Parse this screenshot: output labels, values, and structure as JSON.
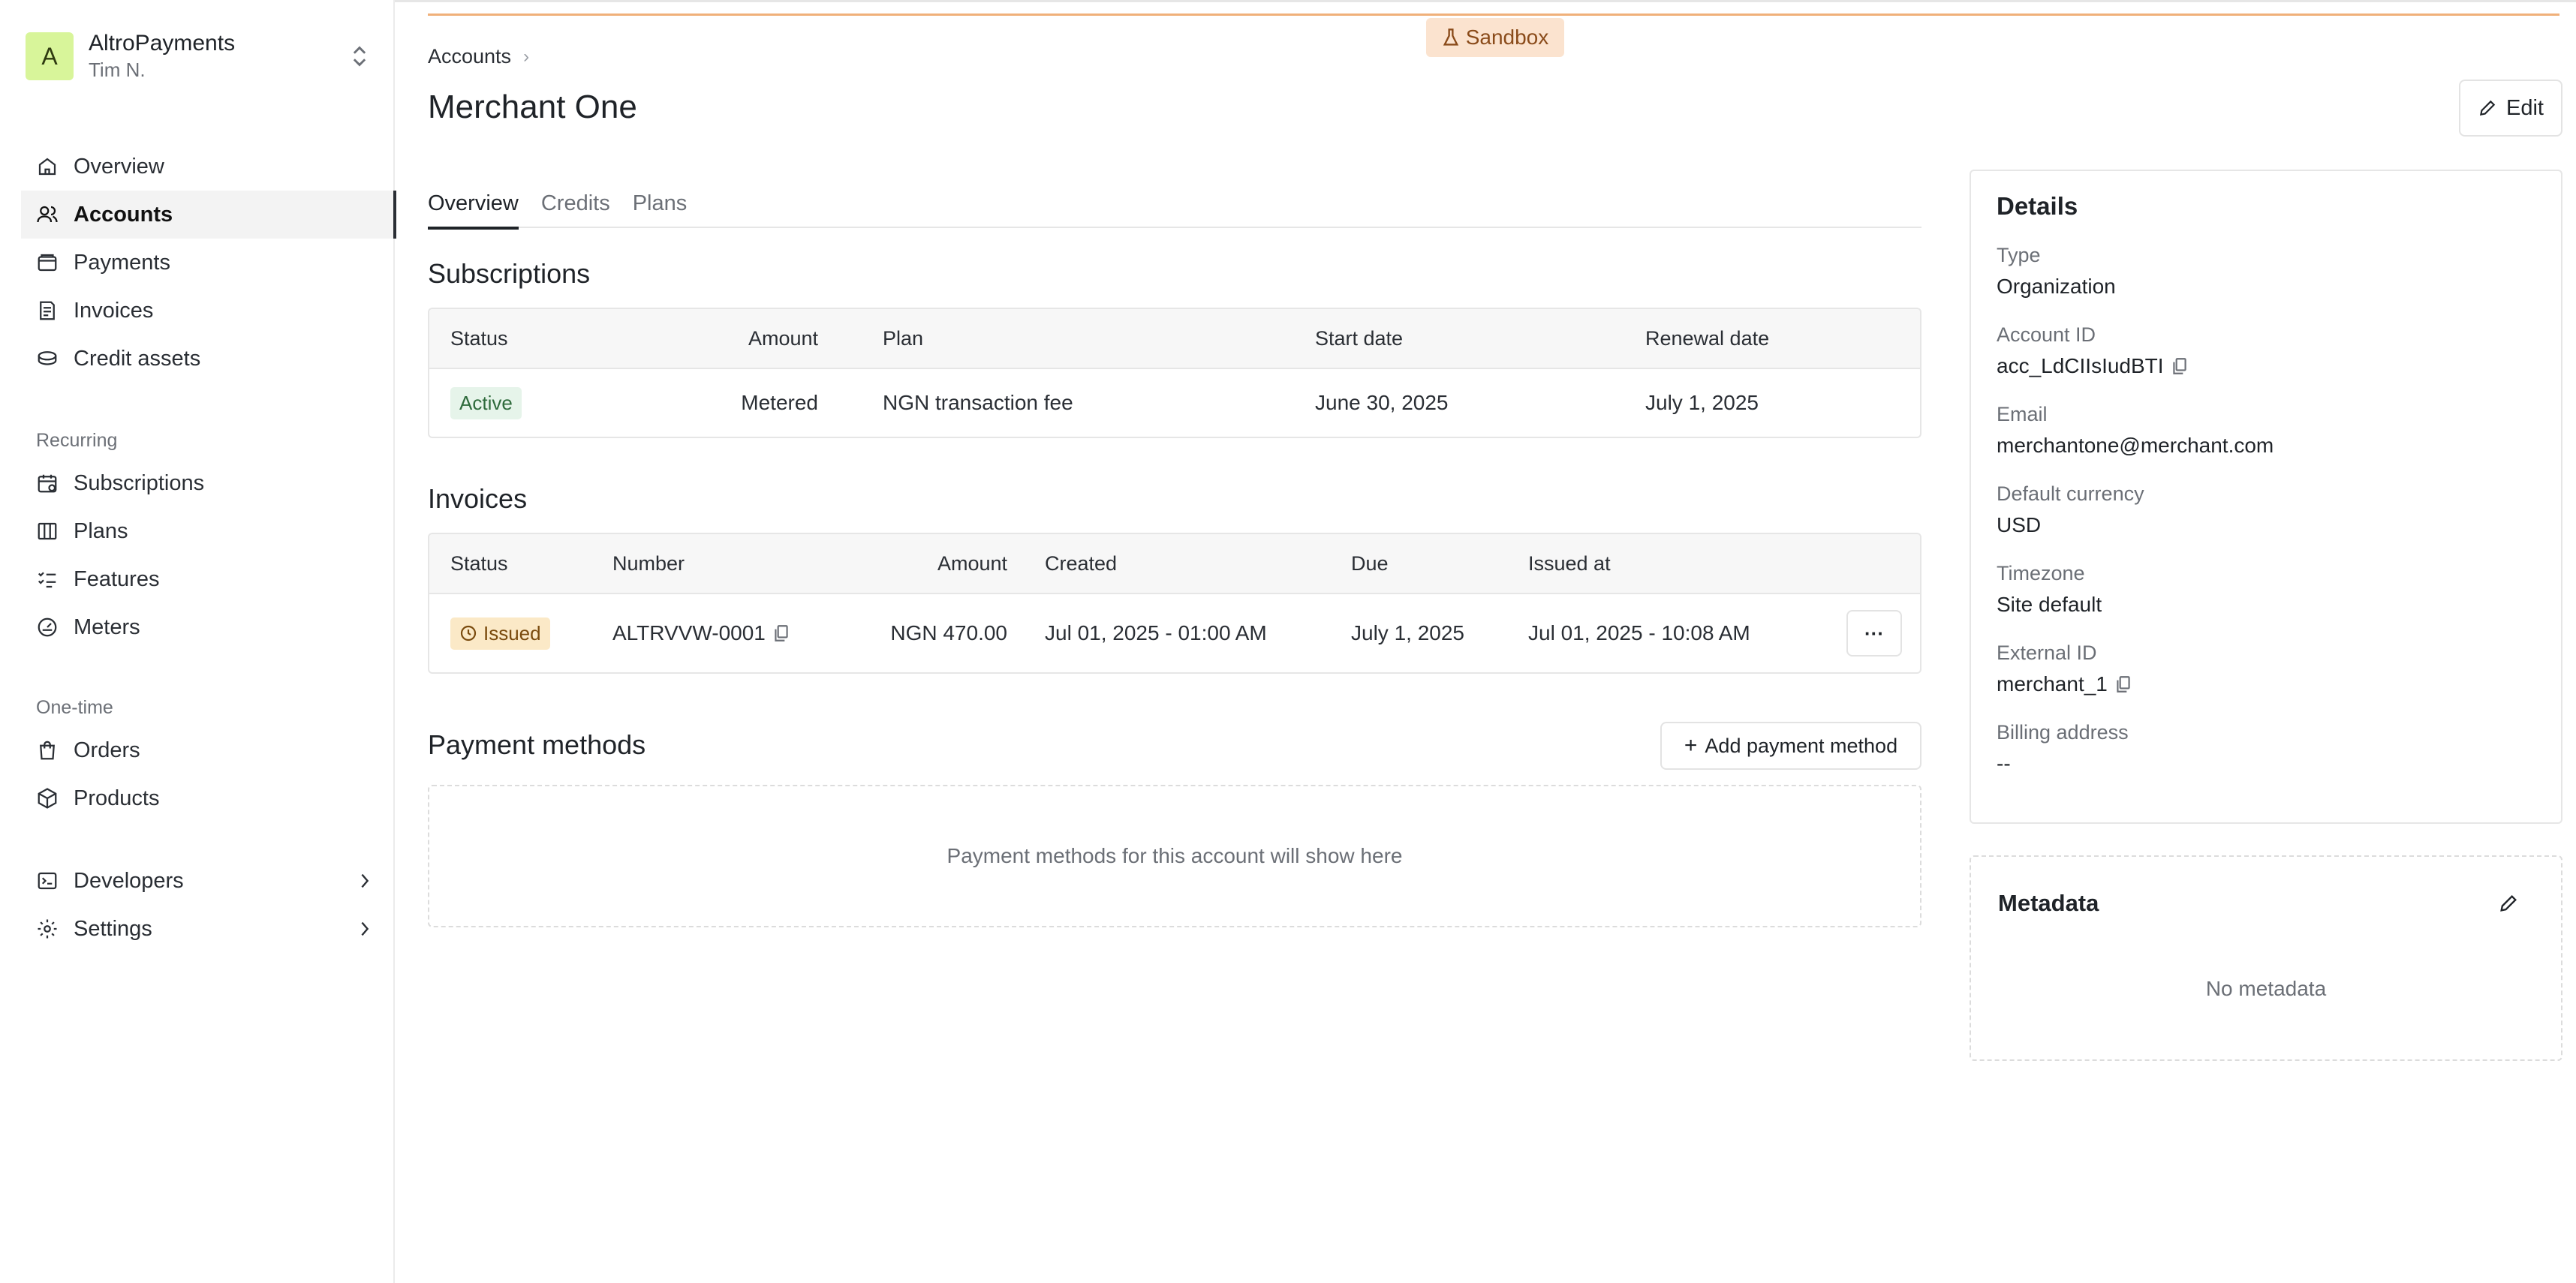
{
  "org": {
    "avatar_letter": "A",
    "name": "AltroPayments",
    "user": "Tim N."
  },
  "sidebar": {
    "main": [
      {
        "label": "Overview",
        "icon": "home-icon"
      },
      {
        "label": "Accounts",
        "icon": "users-icon",
        "active": true
      },
      {
        "label": "Payments",
        "icon": "wallet-icon"
      },
      {
        "label": "Invoices",
        "icon": "invoice-icon"
      },
      {
        "label": "Credit assets",
        "icon": "coins-icon"
      }
    ],
    "recurring_label": "Recurring",
    "recurring": [
      {
        "label": "Subscriptions",
        "icon": "calendar-icon"
      },
      {
        "label": "Plans",
        "icon": "columns-icon"
      },
      {
        "label": "Features",
        "icon": "checklist-icon"
      },
      {
        "label": "Meters",
        "icon": "gauge-icon"
      }
    ],
    "onetime_label": "One-time",
    "onetime": [
      {
        "label": "Orders",
        "icon": "bag-icon"
      },
      {
        "label": "Products",
        "icon": "box-icon"
      }
    ],
    "bottom": [
      {
        "label": "Developers",
        "icon": "terminal-icon"
      },
      {
        "label": "Settings",
        "icon": "gear-icon"
      }
    ]
  },
  "env_badge": "Sandbox",
  "breadcrumb": {
    "root": "Accounts",
    "sep": "›"
  },
  "page_title": "Merchant One",
  "edit_label": "Edit",
  "tabs": [
    "Overview",
    "Credits",
    "Plans"
  ],
  "subscriptions": {
    "title": "Subscriptions",
    "columns": [
      "Status",
      "Amount",
      "Plan",
      "Start date",
      "Renewal date"
    ],
    "rows": [
      {
        "status": "Active",
        "amount": "Metered",
        "plan": "NGN transaction fee",
        "start": "June 30, 2025",
        "renewal": "July 1, 2025"
      }
    ]
  },
  "invoices": {
    "title": "Invoices",
    "columns": [
      "Status",
      "Number",
      "Amount",
      "Created",
      "Due",
      "Issued at"
    ],
    "rows": [
      {
        "status": "Issued",
        "number": "ALTRVVW-0001",
        "amount": "NGN 470.00",
        "created": "Jul 01, 2025 - 01:00 AM",
        "due": "July 1, 2025",
        "issued_at": "Jul 01, 2025 - 10:08 AM",
        "more": "···"
      }
    ]
  },
  "payment_methods": {
    "title": "Payment methods",
    "add_label": "Add payment method",
    "empty": "Payment methods for this account will show here"
  },
  "details": {
    "title": "Details",
    "fields": [
      {
        "label": "Type",
        "value": "Organization"
      },
      {
        "label": "Account ID",
        "value": "acc_LdCIIsIudBTI"
      },
      {
        "label": "Email",
        "value": "merchantone@merchant.com"
      },
      {
        "label": "Default currency",
        "value": "USD"
      },
      {
        "label": "Timezone",
        "value": "Site default"
      },
      {
        "label": "External ID",
        "value": "merchant_1"
      },
      {
        "label": "Billing address",
        "value": "--"
      }
    ]
  },
  "metadata": {
    "title": "Metadata",
    "empty": "No metadata"
  }
}
